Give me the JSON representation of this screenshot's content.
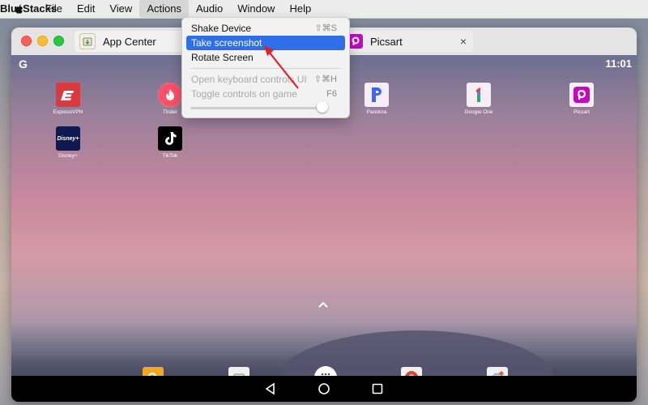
{
  "menubar": {
    "app_name": "BlueStacks",
    "items": [
      "File",
      "Edit",
      "View",
      "Actions",
      "Audio",
      "Window",
      "Help"
    ]
  },
  "window": {
    "tabs": [
      {
        "label": "App Center",
        "icon": "app-center-icon"
      },
      {
        "label": "Picsart",
        "icon": "picsart-icon"
      }
    ],
    "tab_close": "×"
  },
  "actions_menu": {
    "items": [
      {
        "label": "Shake Device",
        "shortcut": "⇧⌘S",
        "state": "normal"
      },
      {
        "label": "Take screenshot",
        "shortcut": "",
        "state": "highlighted"
      },
      {
        "label": "Rotate Screen",
        "shortcut": "",
        "state": "normal"
      },
      {
        "label": "Open keyboard controls UI",
        "shortcut": "⇧⌘H",
        "state": "disabled"
      },
      {
        "label": "Toggle controls on game",
        "shortcut": "F6",
        "state": "disabled"
      }
    ],
    "slider_level": 0.96
  },
  "android": {
    "status": {
      "left_logo": "G",
      "clock": "11:01"
    },
    "apps": [
      {
        "label": "ExpressVPN",
        "icon": "expressvpn-icon",
        "color": "#da3940"
      },
      {
        "label": "Tinder",
        "icon": "tinder-icon",
        "color": "#fd5068"
      },
      {
        "label": "Pandora",
        "icon": "pandora-icon",
        "color": "#3668ff"
      },
      {
        "label": "Google One",
        "icon": "google-one-icon",
        "color": "#ffffff"
      },
      {
        "label": "Picsart",
        "icon": "picsart-icon",
        "color": "#c209c1"
      },
      {
        "label": "Disney+",
        "icon": "disney-plus-icon",
        "color": "#0e1a4f"
      },
      {
        "label": "TikTok",
        "icon": "tiktok-icon",
        "color": "#000000"
      }
    ],
    "dock": [
      {
        "icon": "search-icon",
        "color": "#f5a623"
      },
      {
        "icon": "app-center-icon",
        "color": "#f0f0f0"
      },
      {
        "icon": "apps-grid-icon",
        "color": "#ffffff"
      },
      {
        "icon": "chrome-icon",
        "color": "#f0f0f0"
      },
      {
        "icon": "browser-globe-icon",
        "color": "#f0f0f0"
      }
    ],
    "nav": [
      "back-icon",
      "home-icon",
      "recents-icon"
    ]
  },
  "colors": {
    "highlight": "#2f6ee6",
    "annotation_arrow": "#e31e24"
  }
}
